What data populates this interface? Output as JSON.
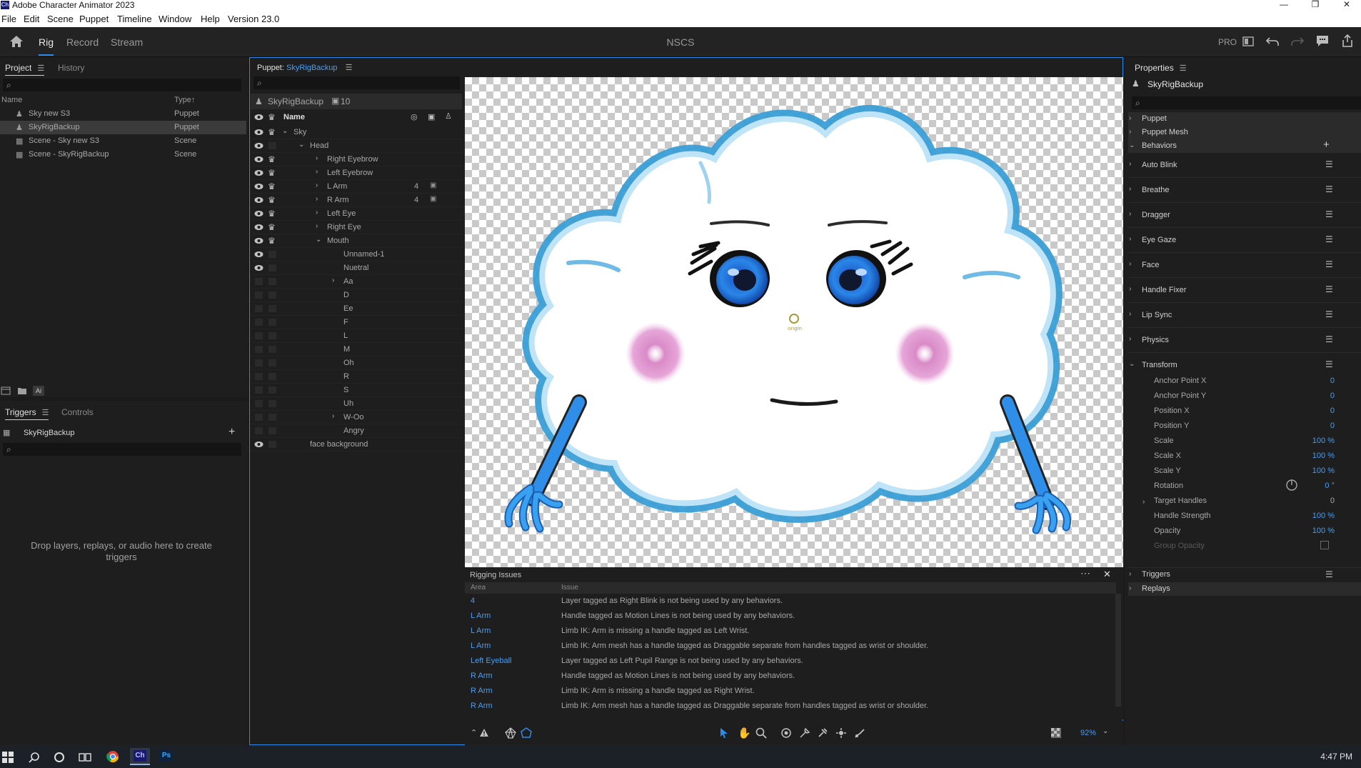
{
  "window": {
    "app_badge": "Ch",
    "title": "Adobe Character Animator 2023",
    "minimize": "—",
    "restore": "❐",
    "close": "✕"
  },
  "menu": [
    "File",
    "Edit",
    "Scene",
    "Puppet",
    "Timeline",
    "Window",
    "Help",
    "Version 23.0"
  ],
  "header": {
    "tabs": [
      "Rig",
      "Record",
      "Stream"
    ],
    "active_tab": "Rig",
    "document": "NSCS",
    "pro_label": "PRO"
  },
  "project": {
    "tabs": [
      "Project",
      "History"
    ],
    "columns": [
      "Name",
      "Type"
    ],
    "sort_arrow": "↑",
    "items": [
      {
        "name": "Sky new S3",
        "type": "Puppet",
        "icon": "puppet-icon",
        "selected": false
      },
      {
        "name": "SkyRigBackup",
        "type": "Puppet",
        "icon": "puppet-icon",
        "selected": true
      },
      {
        "name": "Scene - Sky new S3",
        "type": "Scene",
        "icon": "scene-icon",
        "selected": false
      },
      {
        "name": "Scene - SkyRigBackup",
        "type": "Scene",
        "icon": "scene-icon",
        "selected": false
      }
    ],
    "ai_badge": "Ai"
  },
  "triggers": {
    "tabs": [
      "Triggers",
      "Controls"
    ],
    "puppet": "SkyRigBackup",
    "add": "+",
    "empty_message": "Drop layers, replays, or audio here to create triggers"
  },
  "puppet_panel": {
    "label": "Puppet:",
    "name": "SkyRigBackup",
    "root": "SkyRigBackup",
    "count": "10",
    "name_column": "Name",
    "layers": [
      {
        "label": "Sky",
        "depth": 0,
        "chevron": "open",
        "eye": true,
        "crown": true,
        "num": ""
      },
      {
        "label": "Head",
        "depth": 1,
        "chevron": "open",
        "eye": true,
        "crown": false,
        "num": ""
      },
      {
        "label": "Right Eyebrow",
        "depth": 2,
        "chevron": "closed",
        "eye": true,
        "crown": true,
        "num": ""
      },
      {
        "label": "Left Eyebrow",
        "depth": 2,
        "chevron": "closed",
        "eye": true,
        "crown": true,
        "num": ""
      },
      {
        "label": "L Arm",
        "depth": 2,
        "chevron": "closed",
        "eye": true,
        "crown": true,
        "num": "4"
      },
      {
        "label": "R Arm",
        "depth": 2,
        "chevron": "closed",
        "eye": true,
        "crown": true,
        "num": "4"
      },
      {
        "label": "Left Eye",
        "depth": 2,
        "chevron": "closed",
        "eye": true,
        "crown": true,
        "num": ""
      },
      {
        "label": "Right Eye",
        "depth": 2,
        "chevron": "closed",
        "eye": true,
        "crown": true,
        "num": ""
      },
      {
        "label": "Mouth",
        "depth": 2,
        "chevron": "open",
        "eye": true,
        "crown": true,
        "num": ""
      },
      {
        "label": "Unnamed-1",
        "depth": 3,
        "chevron": "none",
        "eye": true,
        "crown": false,
        "num": ""
      },
      {
        "label": "Nuetral",
        "depth": 3,
        "chevron": "none",
        "eye": true,
        "crown": false,
        "num": ""
      },
      {
        "label": "Aa",
        "depth": 3,
        "chevron": "closed",
        "eye": false,
        "crown": false,
        "num": ""
      },
      {
        "label": "D",
        "depth": 3,
        "chevron": "none",
        "eye": false,
        "crown": false,
        "num": ""
      },
      {
        "label": "Ee",
        "depth": 3,
        "chevron": "none",
        "eye": false,
        "crown": false,
        "num": ""
      },
      {
        "label": "F",
        "depth": 3,
        "chevron": "none",
        "eye": false,
        "crown": false,
        "num": ""
      },
      {
        "label": "L",
        "depth": 3,
        "chevron": "none",
        "eye": false,
        "crown": false,
        "num": ""
      },
      {
        "label": "M",
        "depth": 3,
        "chevron": "none",
        "eye": false,
        "crown": false,
        "num": ""
      },
      {
        "label": "Oh",
        "depth": 3,
        "chevron": "none",
        "eye": false,
        "crown": false,
        "num": ""
      },
      {
        "label": "R",
        "depth": 3,
        "chevron": "none",
        "eye": false,
        "crown": false,
        "num": ""
      },
      {
        "label": "S",
        "depth": 3,
        "chevron": "none",
        "eye": false,
        "crown": false,
        "num": ""
      },
      {
        "label": "Uh",
        "depth": 3,
        "chevron": "none",
        "eye": false,
        "crown": false,
        "num": ""
      },
      {
        "label": "W-Oo",
        "depth": 3,
        "chevron": "closed",
        "eye": false,
        "crown": false,
        "num": ""
      },
      {
        "label": "Angry",
        "depth": 3,
        "chevron": "none",
        "eye": false,
        "crown": false,
        "num": ""
      },
      {
        "label": "face background",
        "depth": 1,
        "chevron": "none",
        "eye": true,
        "crown": false,
        "num": ""
      }
    ]
  },
  "canvas": {
    "origin_label": "origin",
    "zoom": "92%"
  },
  "rigging_issues": {
    "title": "Rigging Issues",
    "columns": [
      "Area",
      "Issue"
    ],
    "rows": [
      {
        "area": "4",
        "issue": "Layer tagged as Right Blink is not being used by any behaviors."
      },
      {
        "area": "L Arm",
        "issue": "Handle tagged as Motion Lines is not being used by any behaviors."
      },
      {
        "area": "L Arm",
        "issue": "Limb IK: Arm is missing a handle tagged as Left Wrist."
      },
      {
        "area": "L Arm",
        "issue": "Limb IK: Arm mesh has a handle tagged as Draggable separate from handles tagged as wrist or shoulder."
      },
      {
        "area": "Left Eyeball",
        "issue": "Layer tagged as Left Pupil Range is not being used by any behaviors."
      },
      {
        "area": "R Arm",
        "issue": "Handle tagged as Motion Lines is not being used by any behaviors."
      },
      {
        "area": "R Arm",
        "issue": "Limb IK: Arm is missing a handle tagged as Right Wrist."
      },
      {
        "area": "R Arm",
        "issue": "Limb IK: Arm mesh has a handle tagged as Draggable separate from handles tagged as wrist or shoulder."
      }
    ]
  },
  "properties": {
    "title": "Properties",
    "puppet": "SkyRigBackup",
    "sections": [
      "Puppet",
      "Puppet Mesh",
      "Behaviors"
    ],
    "behaviors": [
      "Auto Blink",
      "Breathe",
      "Dragger",
      "Eye Gaze",
      "Face",
      "Handle Fixer",
      "Lip Sync",
      "Physics",
      "Transform"
    ],
    "transform": [
      {
        "label": "Anchor Point X",
        "value": "0"
      },
      {
        "label": "Anchor Point Y",
        "value": "0"
      },
      {
        "label": "Position X",
        "value": "0"
      },
      {
        "label": "Position Y",
        "value": "0"
      },
      {
        "label": "Scale",
        "value": "100 %"
      },
      {
        "label": "Scale X",
        "value": "100 %"
      },
      {
        "label": "Scale Y",
        "value": "100 %"
      },
      {
        "label": "Rotation",
        "value": "0 °"
      },
      {
        "label": "Target Handles",
        "value": "0"
      },
      {
        "label": "Handle Strength",
        "value": "100 %"
      },
      {
        "label": "Opacity",
        "value": "100 %"
      },
      {
        "label": "Group Opacity",
        "value": ""
      }
    ],
    "footer_sections": [
      "Triggers",
      "Replays"
    ]
  },
  "taskbar": {
    "time": "4:47 PM",
    "apps": [
      "windows-start-icon",
      "search-icon",
      "cortana-icon",
      "task-view-icon",
      "chrome-icon",
      "character-animator-icon",
      "photoshop-icon"
    ],
    "ch_label": "Ch",
    "ps_label": "Ps"
  },
  "colors": {
    "accent": "#2d8ceb",
    "link": "#4c9df0",
    "panel": "#1e1e1e",
    "cloud_outline": "#3a9fd6",
    "cheek": "#d98ac7"
  }
}
